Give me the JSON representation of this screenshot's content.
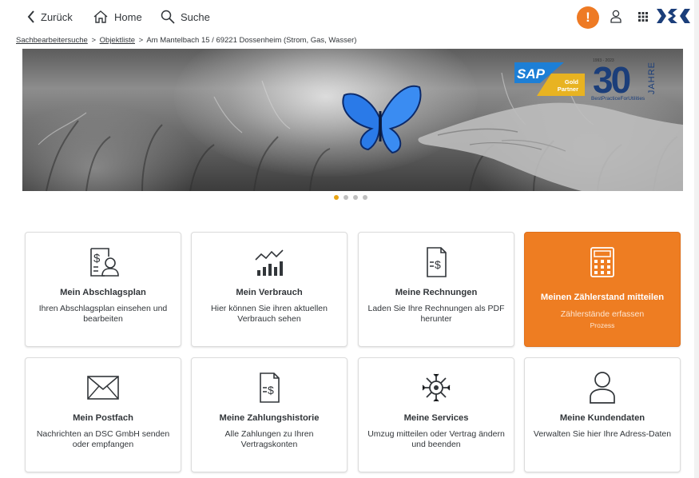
{
  "shell": {
    "back_label": "Zurück",
    "home_label": "Home",
    "search_label": "Suche",
    "alert_glyph": "!"
  },
  "breadcrumb": {
    "items": [
      "Sachbearbeitersuche",
      "Objektliste"
    ],
    "current": "Am Mantelbach 15 / 69221 Dossenheim (Strom, Gas, Wasser)",
    "separator": ">"
  },
  "hero": {
    "sap_text": "SAP",
    "sap_gold": "Gold",
    "sap_partner": "Partner",
    "years_range": "1993 - 2023",
    "anniversary_number": "30",
    "anniversary_word": "JAHRE",
    "tagline": "BestPracticeForUtilities"
  },
  "carousel": {
    "count": 4,
    "active_index": 0
  },
  "colors": {
    "accent": "#ee7d22",
    "alert": "#ee7a24",
    "brand_blue": "#1b3e7a",
    "dot_active": "#e9a514"
  },
  "tiles": [
    {
      "title": "Mein Abschlagsplan",
      "subtitle": "Ihren Abschlagsplan einsehen und bearbeiten",
      "icon": "payment-plan-icon"
    },
    {
      "title": "Mein Verbrauch",
      "subtitle": "Hier können Sie ihren aktuellen Verbrauch sehen",
      "icon": "consumption-chart-icon"
    },
    {
      "title": "Meine Rechnungen",
      "subtitle": "Laden Sie Ihre Rechnungen als PDF herunter",
      "icon": "invoice-icon"
    },
    {
      "title": "Meinen Zählerstand mitteilen",
      "subtitle": "Zählerstände erfassen",
      "process": "Prozess",
      "icon": "calculator-icon"
    },
    {
      "title": "Mein Postfach",
      "subtitle": "Nachrichten an DSC GmbH senden oder empfangen",
      "icon": "envelope-icon"
    },
    {
      "title": "Meine Zahlungshistorie",
      "subtitle": "Alle Zahlungen zu Ihren Vertragskonten",
      "icon": "payment-history-icon"
    },
    {
      "title": "Meine Services",
      "subtitle": "Umzug mitteilen oder Vertrag ändern und beenden",
      "icon": "services-icon"
    },
    {
      "title": "Meine Kundendaten",
      "subtitle": "Verwalten Sie hier Ihre Adress-Daten",
      "icon": "customer-data-icon"
    }
  ]
}
